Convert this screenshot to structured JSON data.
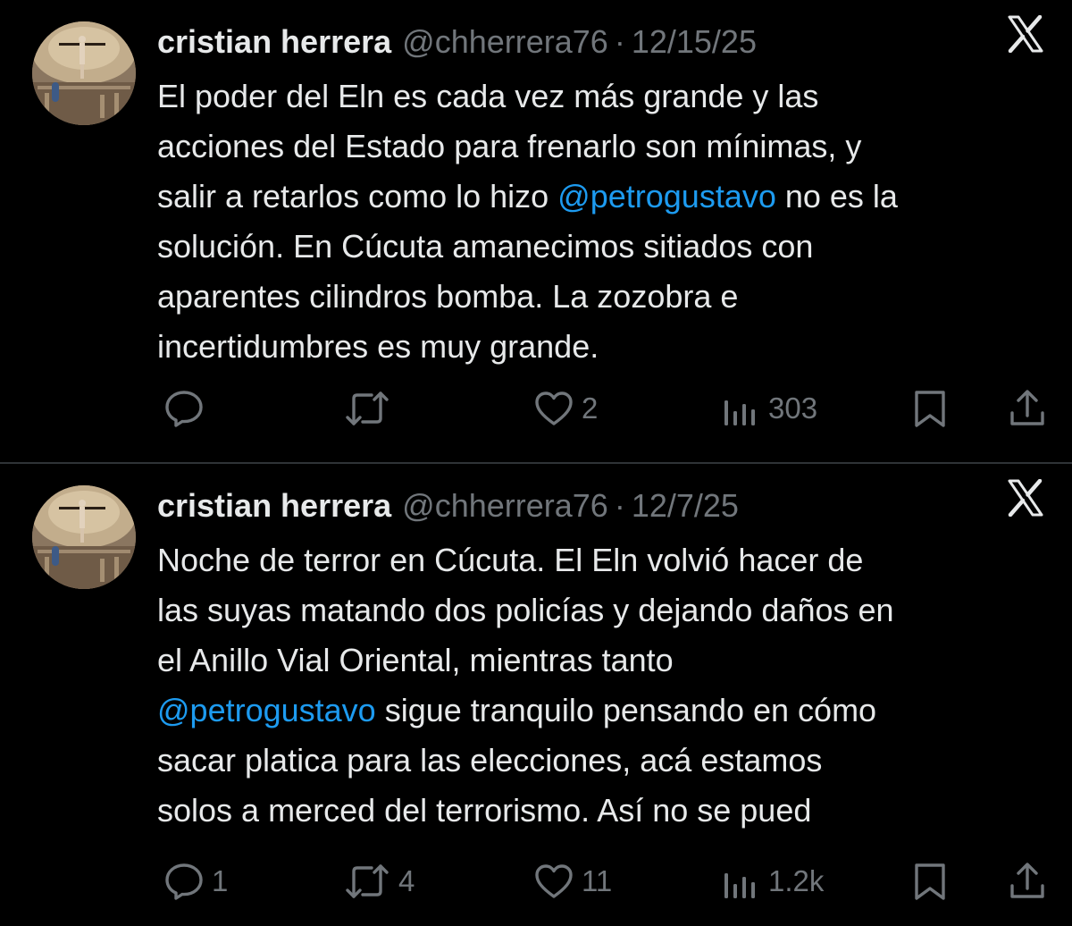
{
  "tweets": [
    {
      "author_name": "cristian herrera",
      "handle": "@chherrera76",
      "separator": "·",
      "date": "12/15/25",
      "platform_icon": "x-logo-icon",
      "text_lines": [
        [
          {
            "text": "El poder del Eln es cada vez más grande y las",
            "type": "plain"
          }
        ],
        [
          {
            "text": "acciones del Estado para frenarlo son mínimas, y",
            "type": "plain"
          }
        ],
        [
          {
            "text": "salir a retarlos como lo hizo ",
            "type": "plain"
          },
          {
            "text": "@petrogustavo",
            "type": "mention"
          },
          {
            "text": " no es la",
            "type": "plain"
          }
        ],
        [
          {
            "text": "solución. En Cúcuta amanecimos sitiados con",
            "type": "plain"
          }
        ],
        [
          {
            "text": "aparentes cilindros bomba. La zozobra e",
            "type": "plain"
          }
        ],
        [
          {
            "text": "incertidumbres es muy grande.",
            "type": "plain"
          }
        ]
      ],
      "actions": {
        "reply": {
          "icon": "reply-icon",
          "count": ""
        },
        "repost": {
          "icon": "repost-icon",
          "count": ""
        },
        "like": {
          "icon": "heart-icon",
          "count": "2"
        },
        "views": {
          "icon": "views-chart-icon",
          "count": "303"
        },
        "bookmark": {
          "icon": "bookmark-icon"
        },
        "share": {
          "icon": "share-icon"
        }
      }
    },
    {
      "author_name": "cristian herrera",
      "handle": "@chherrera76",
      "separator": "·",
      "date": "12/7/25",
      "platform_icon": "x-logo-icon",
      "text_lines": [
        [
          {
            "text": "Noche de terror en Cúcuta. El Eln volvió hacer de",
            "type": "plain"
          }
        ],
        [
          {
            "text": "las suyas matando dos policías y dejando daños en",
            "type": "plain"
          }
        ],
        [
          {
            "text": "el Anillo Vial Oriental, mientras tanto",
            "type": "plain"
          }
        ],
        [
          {
            "text": "@petrogustavo",
            "type": "mention"
          },
          {
            "text": " sigue tranquilo pensando en cómo",
            "type": "plain"
          }
        ],
        [
          {
            "text": "sacar platica para las elecciones, acá estamos",
            "type": "plain"
          }
        ],
        [
          {
            "text": "solos a merced del terrorismo. Así no se pued",
            "type": "plain"
          }
        ]
      ],
      "actions": {
        "reply": {
          "icon": "reply-icon",
          "count": "1"
        },
        "repost": {
          "icon": "repost-icon",
          "count": "4"
        },
        "like": {
          "icon": "heart-icon",
          "count": "11"
        },
        "views": {
          "icon": "views-chart-icon",
          "count": "1.2k"
        },
        "bookmark": {
          "icon": "bookmark-icon"
        },
        "share": {
          "icon": "share-icon"
        }
      }
    }
  ],
  "colors": {
    "background": "#000000",
    "text_primary": "#e7e9ea",
    "text_secondary": "#71767b",
    "mention": "#1d9bf0",
    "divider": "#2f3336"
  }
}
